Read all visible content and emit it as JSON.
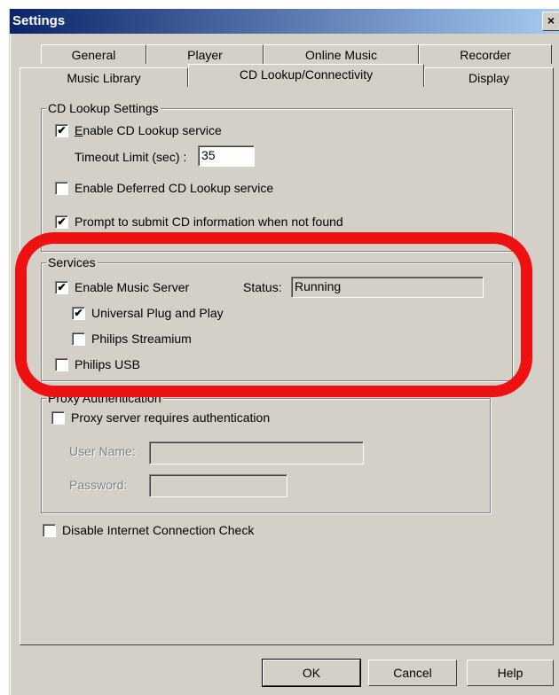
{
  "window": {
    "title": "Settings",
    "close_glyph": "×"
  },
  "tabs": {
    "back_row": [
      "General",
      "Player",
      "Online Music",
      "Recorder"
    ],
    "front_row": [
      "Music Library",
      "CD Lookup/Connectivity",
      "Display"
    ],
    "active": "CD Lookup/Connectivity"
  },
  "cd_lookup": {
    "legend": "CD Lookup Settings",
    "enable_service": {
      "label": "Enable CD Lookup service",
      "checked": true
    },
    "timeout": {
      "label": "Timeout Limit (sec) :",
      "value": "35"
    },
    "deferred": {
      "label": "Enable Deferred CD Lookup service",
      "checked": false
    },
    "prompt_submit": {
      "label": "Prompt to submit CD information when not found",
      "checked": true
    }
  },
  "services": {
    "legend": "Services",
    "music_server": {
      "label": "Enable Music Server",
      "checked": true
    },
    "status_label": "Status:",
    "status_value": "Running",
    "upnp": {
      "label": "Universal Plug and Play",
      "checked": true
    },
    "streamium": {
      "label": "Philips Streamium",
      "checked": false
    },
    "usb": {
      "label": "Philips USB",
      "checked": false
    }
  },
  "proxy": {
    "legend": "Proxy Authentication",
    "requires_auth": {
      "label": "Proxy server requires authentication",
      "checked": false
    },
    "username_label": "User Name:",
    "username_value": "",
    "password_label": "Password:",
    "password_value": ""
  },
  "disable_check": {
    "label": "Disable Internet Connection Check",
    "checked": false
  },
  "buttons": {
    "ok": "OK",
    "cancel": "Cancel",
    "help": "Help"
  },
  "highlight": {
    "color": "#ee1111"
  },
  "check_glyph": "✔"
}
